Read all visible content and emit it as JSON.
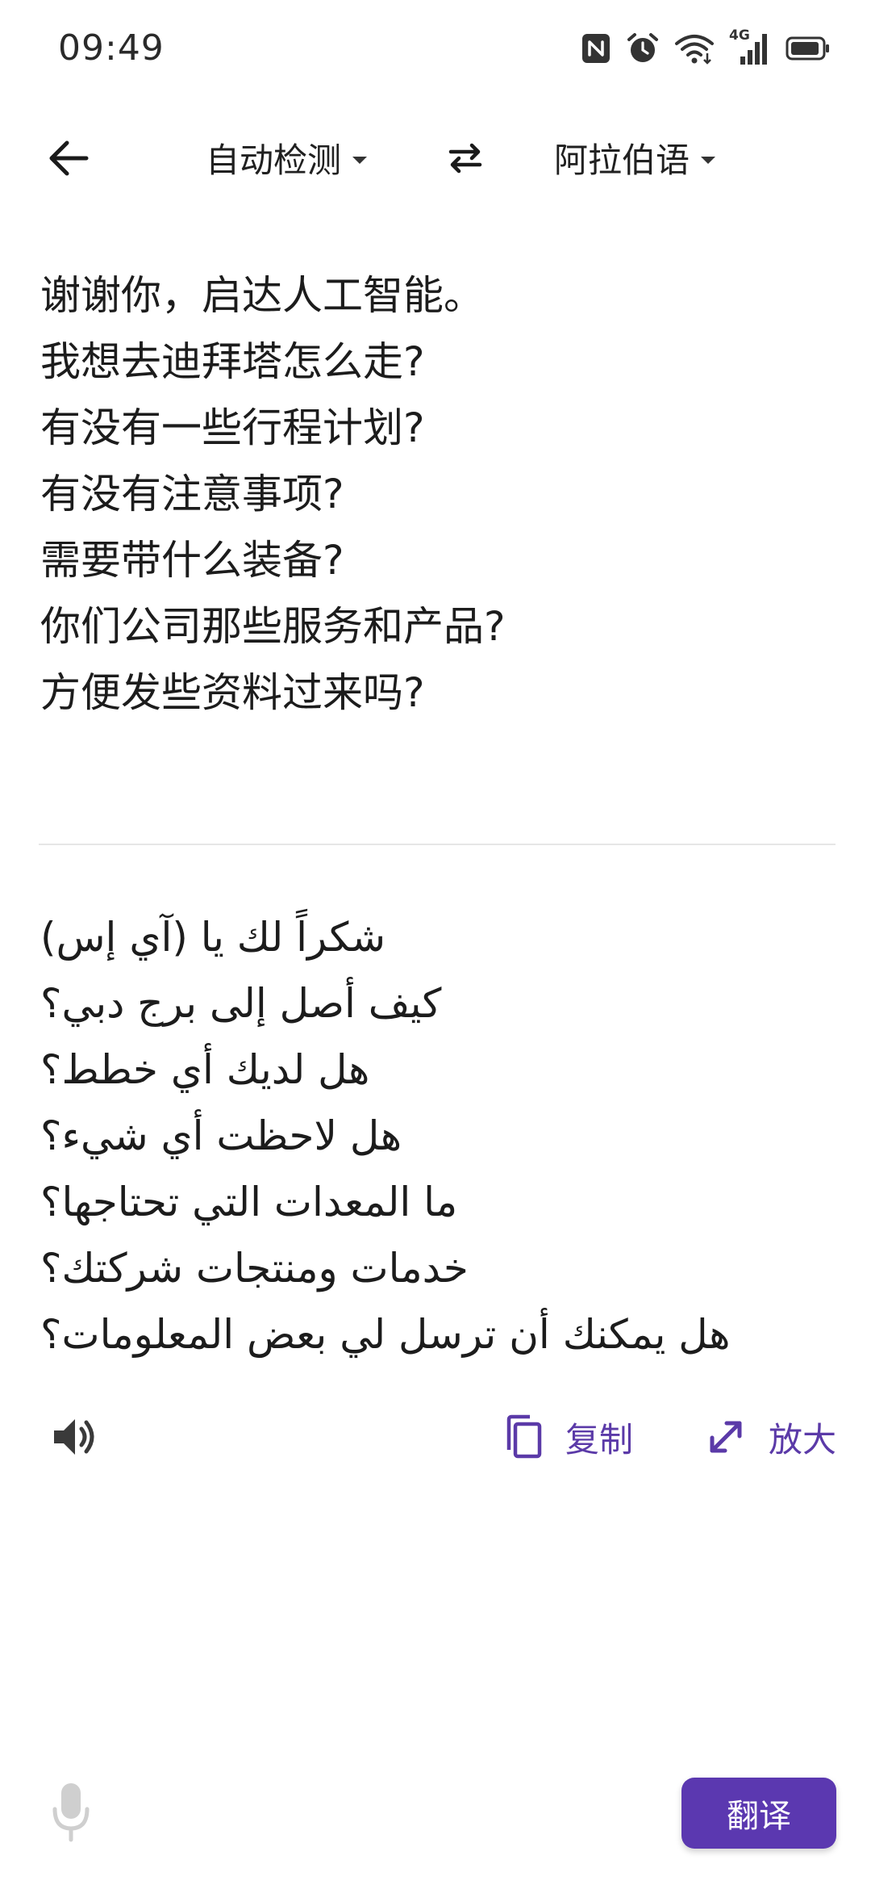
{
  "status_bar": {
    "time": "09:49",
    "network_label": "4G",
    "icons": [
      "nfc-icon",
      "alarm-icon",
      "wifi-icon",
      "cellular-signal-icon",
      "battery-icon"
    ]
  },
  "toolbar": {
    "source_language": "自动检测",
    "target_language": "阿拉伯语"
  },
  "source_text": [
    "谢谢你，启达人工智能。",
    "我想去迪拜塔怎么走?",
    "有没有一些行程计划?",
    "有没有注意事项?",
    "需要带什么装备?",
    "你们公司那些服务和产品?",
    "方便发些资料过来吗?"
  ],
  "translated_text": [
    "شكراً لك يا (آي إس)",
    "كيف أصل إلى برج دبي؟",
    "هل لديك أي خطط؟",
    "هل لاحظت أي شيء؟",
    "ما المعدات التي تحتاجها؟",
    "خدمات ومنتجات شركتك؟",
    "هل يمكنك أن ترسل لي بعض المعلومات؟"
  ],
  "actions": {
    "copy_label": "复制",
    "zoom_label": "放大"
  },
  "translate_button_label": "翻译",
  "colors": {
    "accent": "#5b38b0",
    "text": "#1c1c1c",
    "divider": "#e6e6e6",
    "mic_disabled": "#cfcfcf"
  }
}
